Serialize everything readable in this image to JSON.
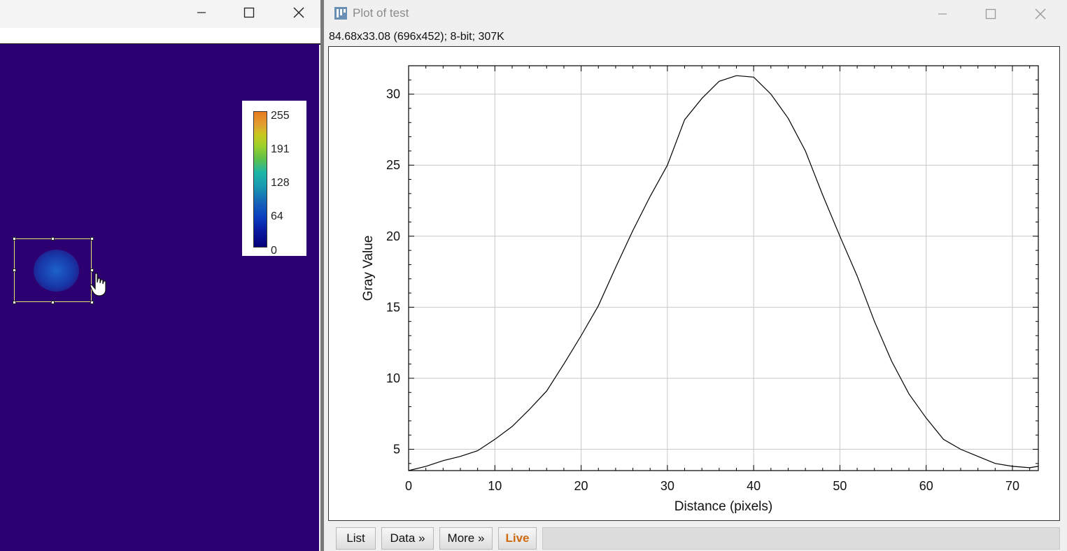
{
  "left_window": {
    "lut_labels": [
      "255",
      "191",
      "128",
      "64",
      "0"
    ]
  },
  "plot_window": {
    "title": "Plot of test",
    "info": "84.68x33.08  (696x452); 8-bit; 307K",
    "buttons": {
      "list": "List",
      "data": "Data »",
      "more": "More »",
      "live": "Live"
    }
  },
  "chart_data": {
    "type": "line",
    "xlabel": "Distance (pixels)",
    "ylabel": "Gray Value",
    "xlim": [
      0,
      73
    ],
    "ylim": [
      3.5,
      32
    ],
    "xticks": [
      0,
      10,
      20,
      30,
      40,
      50,
      60,
      70
    ],
    "yticks": [
      5,
      10,
      15,
      20,
      25,
      30
    ],
    "grid": true,
    "series": [
      {
        "x": [
          0,
          2,
          4,
          6,
          8,
          10,
          12,
          14,
          16,
          18,
          20,
          22,
          24,
          26,
          28,
          30,
          32,
          34,
          36,
          38,
          40,
          42,
          44,
          46,
          48,
          50,
          52,
          54,
          56,
          58,
          60,
          62,
          64,
          66,
          68,
          70,
          72,
          73
        ],
        "y": [
          3.5,
          3.8,
          4.2,
          4.5,
          4.9,
          5.7,
          6.6,
          7.8,
          9.1,
          11.0,
          13.0,
          15.1,
          17.8,
          20.4,
          22.8,
          25.0,
          28.2,
          29.7,
          30.9,
          31.3,
          31.2,
          30.0,
          28.3,
          26.0,
          22.9,
          20.0,
          17.2,
          14.0,
          11.2,
          8.9,
          7.2,
          5.7,
          5.0,
          4.5,
          4.0,
          3.8,
          3.7,
          3.8
        ]
      }
    ]
  }
}
